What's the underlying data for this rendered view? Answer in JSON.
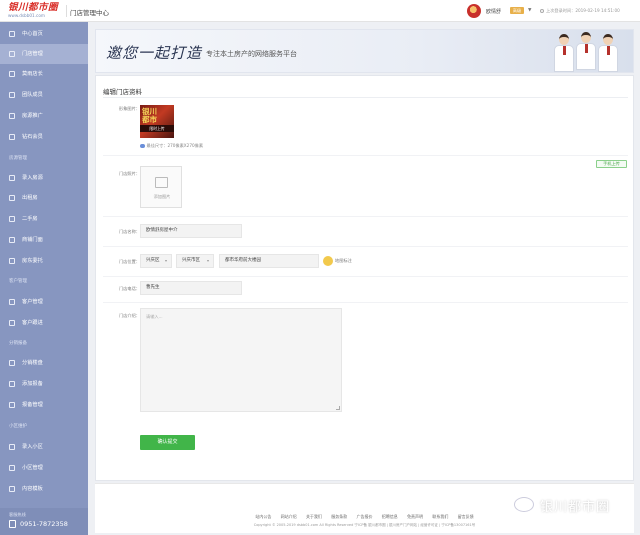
{
  "header": {
    "logo_text": "银川都市圈",
    "logo_url": "www.dsbb01.com",
    "system_title": "门店管理中心",
    "user_name": "欧情舒",
    "user_badge": "高级",
    "login_info": "上次登录时间：2019-02-19 14:51:00"
  },
  "sidebar": {
    "items": [
      {
        "label": "中心首页",
        "icon": "home-icon"
      },
      {
        "label": "门店管理",
        "icon": "store-icon",
        "active": true
      },
      {
        "label": "莫雨店长",
        "icon": "user-icon"
      },
      {
        "label": "团队成员",
        "icon": "team-icon"
      },
      {
        "label": "房源推广",
        "icon": "promote-icon"
      },
      {
        "label": "钻石会员",
        "icon": "diamond-icon"
      },
      {
        "label": "录入房源",
        "icon": "edit-icon"
      },
      {
        "label": "出租房",
        "icon": "key-icon"
      },
      {
        "label": "二手房",
        "icon": "house-icon"
      },
      {
        "label": "商铺门面",
        "icon": "shop-icon"
      },
      {
        "label": "房东委托",
        "icon": "handshake-icon"
      },
      {
        "label": "客户管理",
        "icon": "customer-icon"
      },
      {
        "label": "客户跟进",
        "icon": "chart-icon"
      },
      {
        "label": "分销楼盘",
        "icon": "building-icon"
      },
      {
        "label": "添加报备",
        "icon": "add-icon"
      },
      {
        "label": "报备管理",
        "icon": "list-icon"
      },
      {
        "label": "录入小区",
        "icon": "edit-icon"
      },
      {
        "label": "小区管理",
        "icon": "community-icon"
      },
      {
        "label": "内容模板",
        "icon": "template-icon"
      }
    ],
    "groups": [
      "房源管理",
      "客户管理",
      "分销报备",
      "小区维护"
    ],
    "hotline_label": "客服热线",
    "hotline": "0951-7872358"
  },
  "banner": {
    "headline": "邀您一起打造",
    "subline": "专注本土房产的网络服务平台"
  },
  "form": {
    "title": "编辑门店资料",
    "cover_label": "形象图片：",
    "cover_text_line1": "银川",
    "cover_text_line2": "都市",
    "cover_band": "限时上传",
    "cover_hint": "最佳尺寸：270像素X270像素",
    "mobile_upload_label": "手机上传",
    "photo_label": "门店照片：",
    "add_photo_label": "添加图片",
    "name_label": "门店名称：",
    "name_value": "欧情舒房屋中介",
    "location_label": "门店位置：",
    "city_value": "兴庆区",
    "district_value": "兴庆市区",
    "address_value": "都市华府前大楼园",
    "map_label": "地图标注",
    "phone_label": "门店电话：",
    "phone_value": "曹先生",
    "intro_label": "门店介绍：",
    "intro_placeholder": "请输入...",
    "submit_label": "确认提交"
  },
  "footer": {
    "links": [
      "站内公告",
      "网站介绍",
      "关于我们",
      "服务条款",
      "广告报价",
      "招聘信息",
      "免责声明",
      "联系我们",
      "留言反馈"
    ],
    "copyright": "Copyright © 2005-2019 dsbb01.com All Rights Reserved 宁ICP备 银川都市圈 | 银川房产门户网站 | 经营许可证 | 宁ICP备13007161号"
  },
  "watermark": "银川都市圈"
}
